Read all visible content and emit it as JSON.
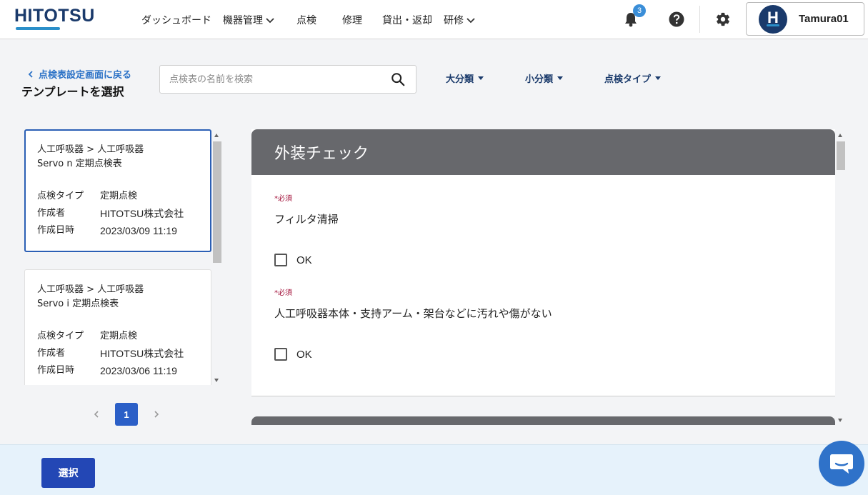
{
  "header": {
    "logo": "HITOTSU",
    "nav": [
      {
        "label": "ダッシュボード",
        "dropdown": false
      },
      {
        "label": "機器管理",
        "dropdown": true
      },
      {
        "label": "点検",
        "dropdown": false
      },
      {
        "label": "修理",
        "dropdown": false
      },
      {
        "label": "貸出・返却",
        "dropdown": false
      },
      {
        "label": "研修",
        "dropdown": true
      }
    ],
    "notification_count": "3",
    "user_initial": "H",
    "user_name": "Tamura01",
    "icons": [
      "bell-icon",
      "help-icon",
      "gear-icon"
    ]
  },
  "top": {
    "back_link": "点検表設定画面に戻る",
    "title": "テンプレートを選択",
    "search_placeholder": "点検表の名前を検索",
    "filters": [
      "大分類",
      "小分類",
      "点検タイプ"
    ]
  },
  "templates": [
    {
      "path": "人工呼吸器 > 人工呼吸器",
      "name": "Servo n 定期点検表",
      "type_label": "点検タイプ",
      "type": "定期点検",
      "author_label": "作成者",
      "author": "HITOTSU株式会社",
      "date_label": "作成日時",
      "date": "2023/03/09 11:19",
      "selected": true
    },
    {
      "path": "人工呼吸器 > 人工呼吸器",
      "name": "Servo i 定期点検表",
      "type_label": "点検タイプ",
      "type": "定期点検",
      "author_label": "作成者",
      "author": "HITOTSU株式会社",
      "date_label": "作成日時",
      "date": "2023/03/06 11:19",
      "selected": false
    }
  ],
  "pagination": {
    "current": "1"
  },
  "preview": {
    "section_title": "外装チェック",
    "items": [
      {
        "required": "*必須",
        "question": "フィルタ清掃",
        "option": "OK"
      },
      {
        "required": "*必須",
        "question": "人工呼吸器本体・支持アーム・架台などに汚れや傷がない",
        "option": "OK"
      }
    ]
  },
  "footer": {
    "select_label": "選択"
  },
  "colors": {
    "brand": "#1a3a6b",
    "accent": "#2b5fc7",
    "section_header": "#67686c",
    "required": "#a3133b"
  }
}
